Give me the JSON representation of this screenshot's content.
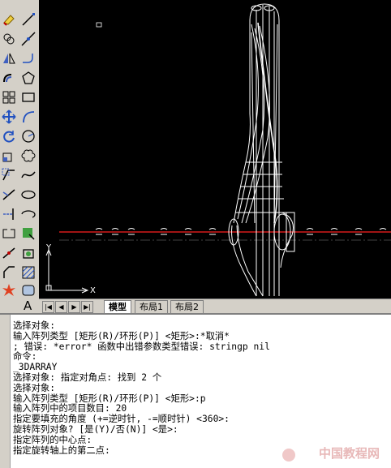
{
  "toolbar": {
    "icons": [
      "erase-icon",
      "line-icon",
      "copy-icon",
      "xline-icon",
      "mirror-icon",
      "polyline-icon",
      "offset-icon",
      "polygon-icon",
      "array-icon",
      "rectangle-icon",
      "move-icon",
      "arc-icon",
      "rotate-icon",
      "circle-icon",
      "scale-icon",
      "revcloud-icon",
      "stretch-icon",
      "spline-icon",
      "trim-icon",
      "ellipse-icon",
      "extend-icon",
      "ellipse-arc-icon",
      "break-icon",
      "insert-block-icon",
      "break-at-point-icon",
      "make-block-icon",
      "join-icon",
      "point-icon",
      "chamfer-icon",
      "hatch-icon",
      "fillet-icon",
      "gradient-icon",
      "explode-icon",
      "region-icon",
      "text-icon"
    ]
  },
  "canvas": {
    "ucs_x": "X",
    "ucs_y": "Y",
    "colors": {
      "background": "#000000",
      "geometry": "#ffffff",
      "centerline": "#ff2020"
    }
  },
  "layout_tabs": {
    "model": "模型",
    "layout1": "布局1",
    "layout2": "布局2",
    "nav": [
      "|◀",
      "◀",
      "▶",
      "▶|"
    ]
  },
  "command_line": [
    "选择对象:",
    "输入阵列类型 [矩形(R)/环形(P)] <矩形>:*取消*",
    "; 错误: *error* 函数中出错参数类型错误: stringp nil",
    "命令:",
    "_3DARRAY",
    "选择对象: 指定对角点: 找到 2 个",
    "选择对象:",
    "输入阵列类型 [矩形(R)/环形(P)] <矩形>:p",
    "输入阵列中的项目数目: 20",
    "指定要填充的角度 (+=逆时针, -=顺时针) <360>:",
    "旋转阵列对象? [是(Y)/否(N)] <是>:",
    "指定阵列的中心点:",
    "指定旋转轴上的第二点:"
  ],
  "watermark": "中国教程网"
}
